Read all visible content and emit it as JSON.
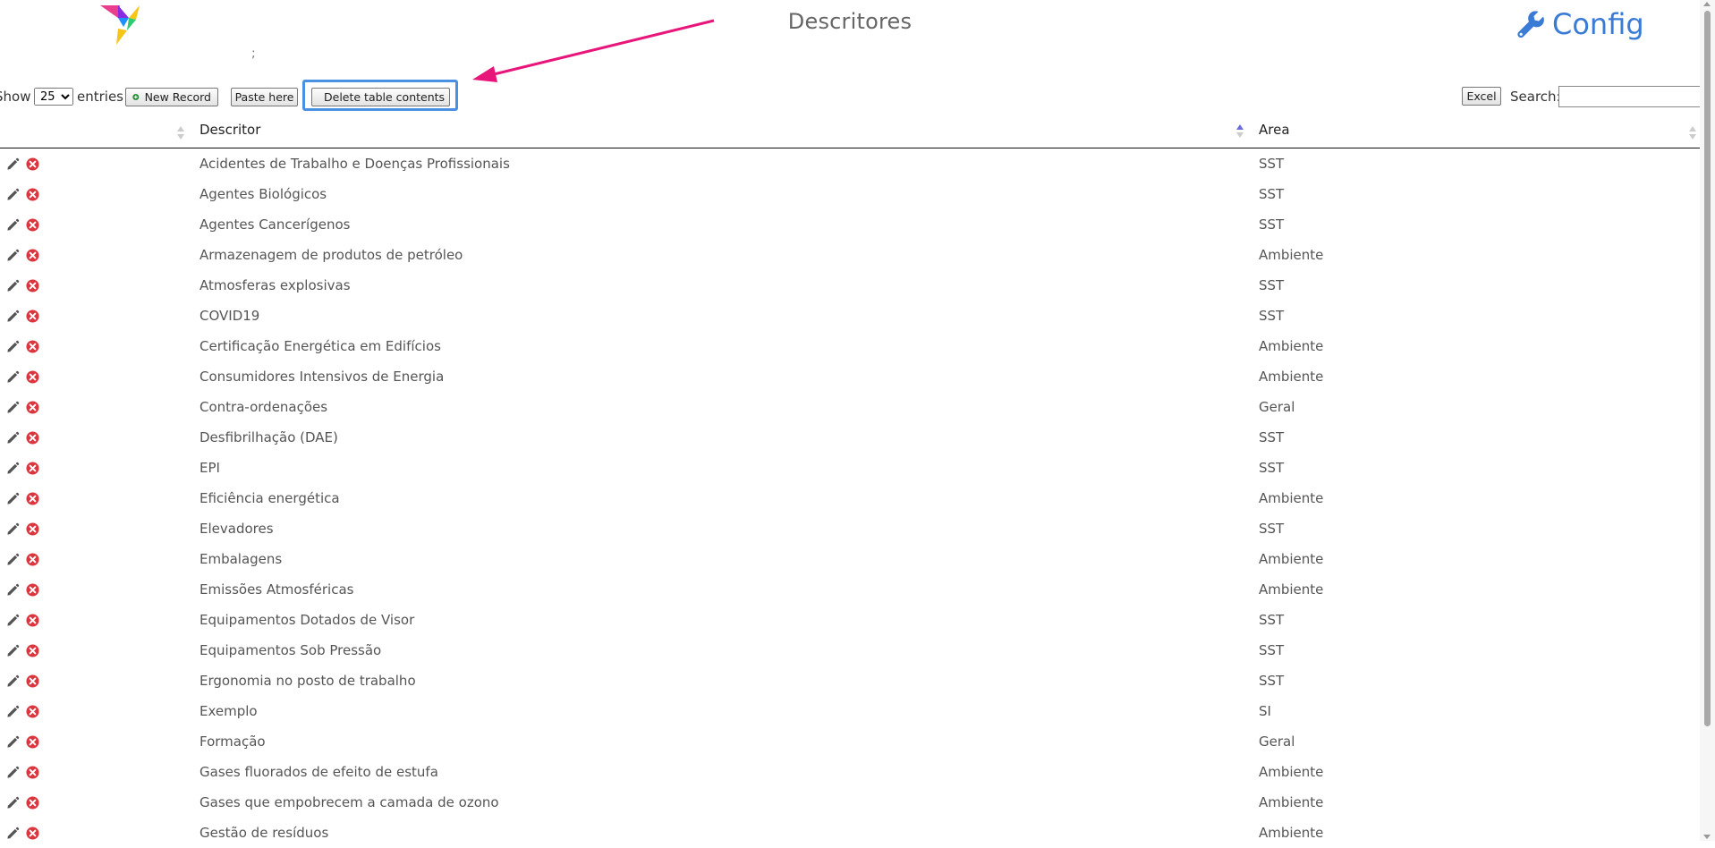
{
  "header": {
    "title": "Descritores",
    "config_label": "Config",
    "stray_text": ";"
  },
  "toolbar": {
    "show_label": "Show",
    "page_length": "25",
    "entries_label": "entries",
    "new_record_label": "New Record",
    "paste_label": "Paste here",
    "delete_label": "Delete table contents",
    "excel_label": "Excel",
    "search_label": "Search:",
    "search_value": ""
  },
  "table": {
    "columns": [
      "Descritor",
      "Area"
    ],
    "rows": [
      {
        "descritor": "Acidentes de Trabalho e Doenças Profissionais",
        "area": "SST"
      },
      {
        "descritor": "Agentes Biológicos",
        "area": "SST"
      },
      {
        "descritor": "Agentes Cancerígenos",
        "area": "SST"
      },
      {
        "descritor": "Armazenagem de produtos de petróleo",
        "area": "Ambiente"
      },
      {
        "descritor": "Atmosferas explosivas",
        "area": "SST"
      },
      {
        "descritor": "COVID19",
        "area": "SST"
      },
      {
        "descritor": "Certificação Energética em Edifícios",
        "area": "Ambiente"
      },
      {
        "descritor": "Consumidores Intensivos de Energia",
        "area": "Ambiente"
      },
      {
        "descritor": "Contra-ordenações",
        "area": "Geral"
      },
      {
        "descritor": "Desfibrilhação (DAE)",
        "area": "SST"
      },
      {
        "descritor": "EPI",
        "area": "SST"
      },
      {
        "descritor": "Eficiência energética",
        "area": "Ambiente"
      },
      {
        "descritor": "Elevadores",
        "area": "SST"
      },
      {
        "descritor": "Embalagens",
        "area": "Ambiente"
      },
      {
        "descritor": "Emissões Atmosféricas",
        "area": "Ambiente"
      },
      {
        "descritor": "Equipamentos Dotados de Visor",
        "area": "SST"
      },
      {
        "descritor": "Equipamentos Sob Pressão",
        "area": "SST"
      },
      {
        "descritor": "Ergonomia no posto de trabalho",
        "area": "SST"
      },
      {
        "descritor": "Exemplo",
        "area": "SI"
      },
      {
        "descritor": "Formação",
        "area": "Geral"
      },
      {
        "descritor": "Gases fluorados de efeito de estufa",
        "area": "Ambiente"
      },
      {
        "descritor": "Gases que empobrecem a camada de ozono",
        "area": "Ambiente"
      },
      {
        "descritor": "Gestão de resíduos",
        "area": "Ambiente"
      }
    ]
  },
  "icons": {
    "edit": "pencil-icon",
    "delete": "delete-circle-icon",
    "trash": "trash-icon",
    "add": "plus-circle-icon",
    "config": "wrench-icon"
  },
  "colors": {
    "accent": "#3a7bd5",
    "highlight_border": "#4a90e2",
    "annotation_arrow": "#e8157a",
    "delete_icon": "#d9363e",
    "add_icon": "#2e8b3a"
  }
}
